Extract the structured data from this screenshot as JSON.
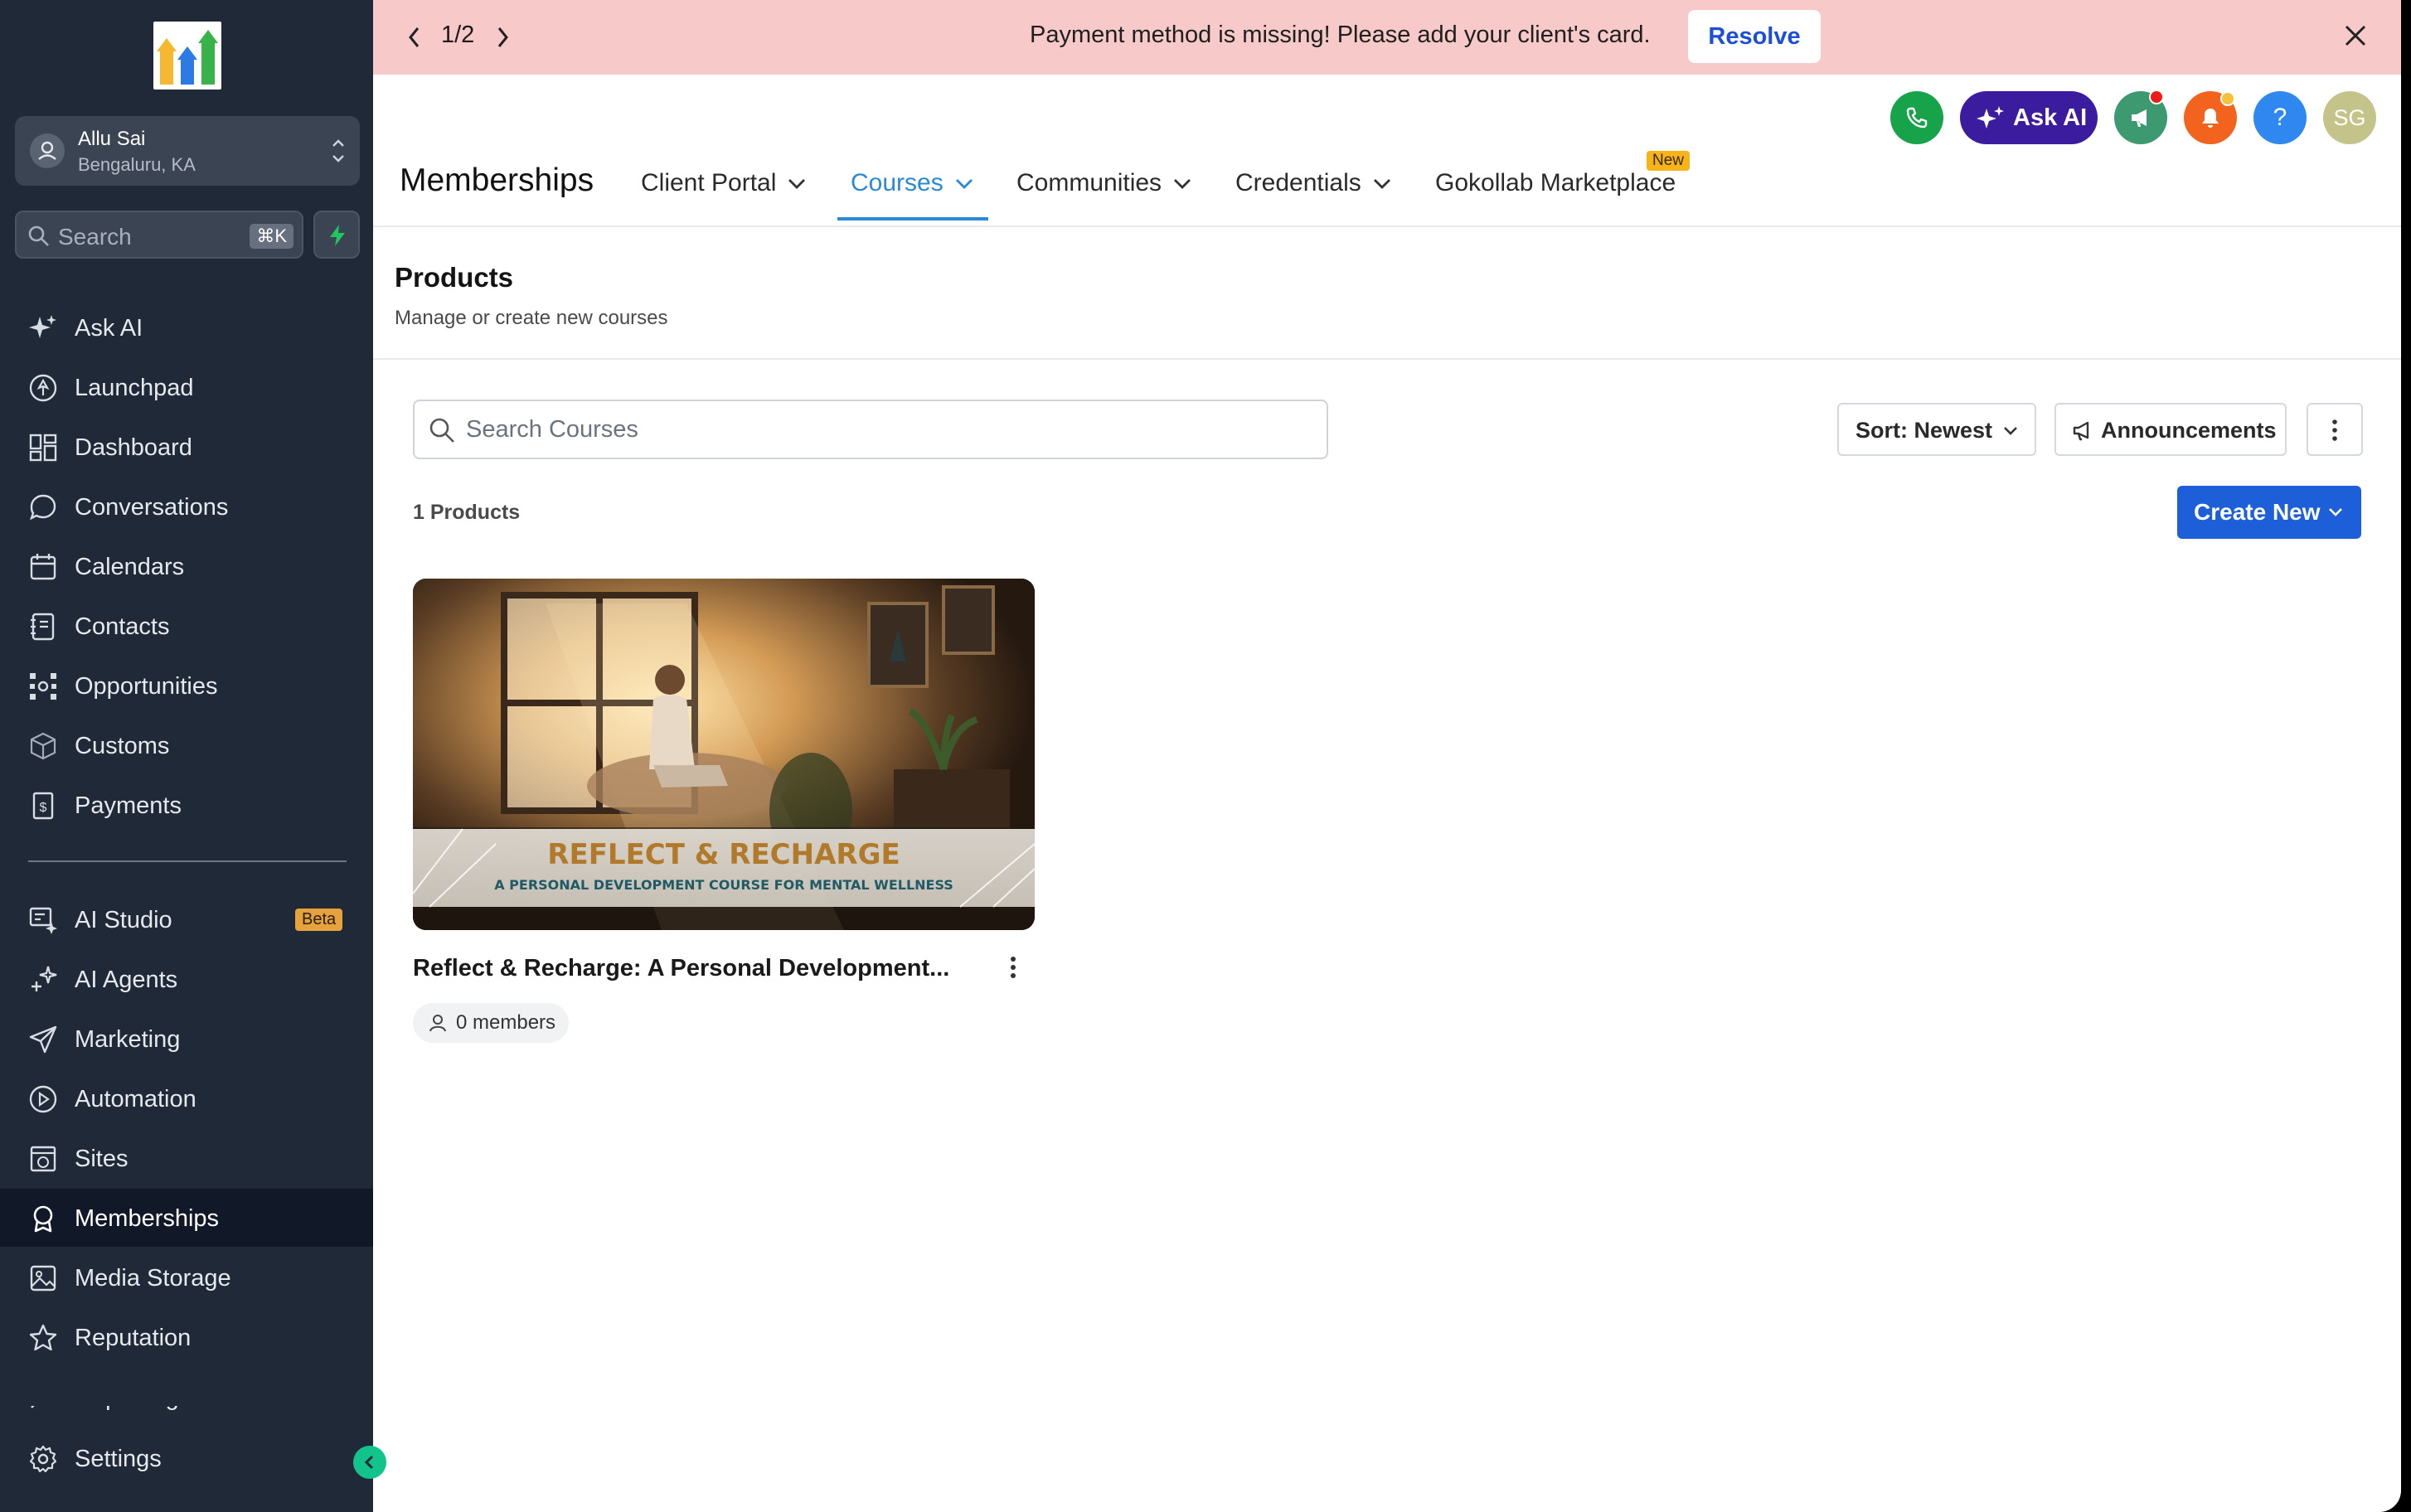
{
  "banner": {
    "page_indicator": "1/2",
    "message": "Payment method is missing! Please add your client's card.",
    "action_label": "Resolve"
  },
  "account": {
    "name": "Allu Sai",
    "location": "Bengaluru, KA"
  },
  "sidebar_search": {
    "label": "Search",
    "shortcut": "⌘K"
  },
  "sidebar": {
    "items": [
      {
        "label": "Ask AI",
        "icon": "sparkle-icon"
      },
      {
        "label": "Launchpad",
        "icon": "rocket-icon"
      },
      {
        "label": "Dashboard",
        "icon": "dashboard-grid-icon"
      },
      {
        "label": "Conversations",
        "icon": "chat-bubble-icon"
      },
      {
        "label": "Calendars",
        "icon": "calendar-icon"
      },
      {
        "label": "Contacts",
        "icon": "contact-book-icon"
      },
      {
        "label": "Opportunities",
        "icon": "network-icon"
      },
      {
        "label": "Customs",
        "icon": "cube-icon"
      },
      {
        "label": "Payments",
        "icon": "receipt-icon"
      }
    ],
    "items2": [
      {
        "label": "AI Studio",
        "icon": "ai-studio-icon",
        "badge": "Beta"
      },
      {
        "label": "AI Agents",
        "icon": "ai-agents-icon"
      },
      {
        "label": "Marketing",
        "icon": "send-icon"
      },
      {
        "label": "Automation",
        "icon": "automation-icon"
      },
      {
        "label": "Sites",
        "icon": "sites-icon"
      },
      {
        "label": "Memberships",
        "icon": "award-icon"
      },
      {
        "label": "Media Storage",
        "icon": "image-icon"
      },
      {
        "label": "Reputation",
        "icon": "star-icon"
      },
      {
        "label": "Reporting",
        "icon": "chart-icon"
      }
    ],
    "settings_label": "Settings"
  },
  "topbar": {
    "ask_ai_label": "Ask AI",
    "help_label": "?",
    "avatar_initials": "SG"
  },
  "header": {
    "title": "Memberships",
    "tabs": [
      {
        "label": "Client Portal",
        "dropdown": true
      },
      {
        "label": "Courses",
        "dropdown": true,
        "active": true
      },
      {
        "label": "Communities",
        "dropdown": true
      },
      {
        "label": "Credentials",
        "dropdown": true
      },
      {
        "label": "Gokollab Marketplace",
        "dropdown": false,
        "badge": "New"
      }
    ]
  },
  "section": {
    "title": "Products",
    "subtitle": "Manage or create new courses"
  },
  "toolbar": {
    "search_placeholder": "Search Courses",
    "sort_label": "Sort: Newest",
    "announcements_label": "Announcements",
    "count_label": "1 Products",
    "create_label": "Create New"
  },
  "products": [
    {
      "thumbnail_heading": "REFLECT & RECHARGE",
      "thumbnail_subheading": "A PERSONAL DEVELOPMENT COURSE FOR MENTAL WELLNESS",
      "title": "Reflect & Recharge: A Personal Development...",
      "members": "0 members"
    }
  ],
  "colors": {
    "sidebar_bg": "#1f2937",
    "banner_bg": "#f7c9c9",
    "primary": "#1d5fd8",
    "tab_active": "#2b89d8"
  }
}
